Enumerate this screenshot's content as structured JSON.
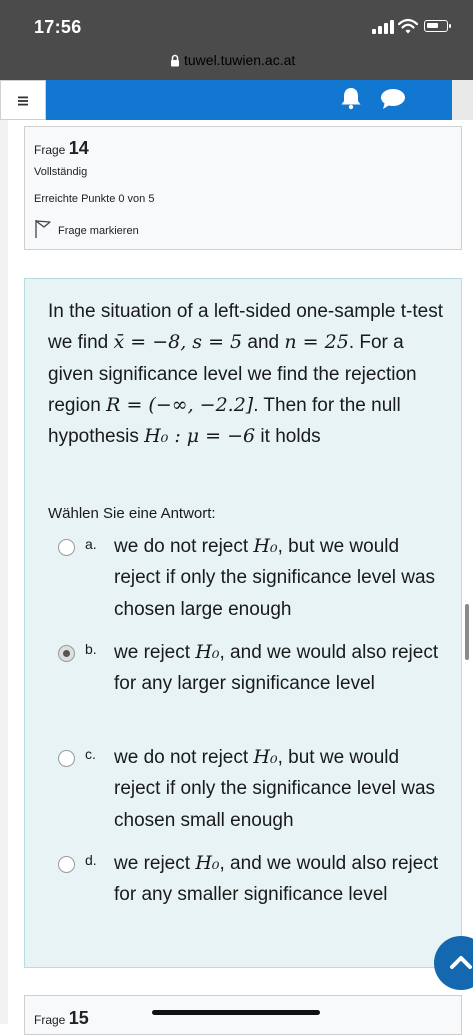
{
  "status_bar": {
    "time": "17:56"
  },
  "browser": {
    "url": "tuwel.tuwien.ac.at"
  },
  "nav": {
    "menu_icon": "hamburger-icon",
    "bell_icon": "bell-icon",
    "chat_icon": "chat-bubble-icon",
    "accent": "#1177d1"
  },
  "question_info": {
    "frage_label": "Frage",
    "number": "14",
    "status": "Vollständig",
    "points": "Erreichte Punkte 0 von 5",
    "flag_label": "Frage markieren"
  },
  "question": {
    "t1": "In the situation of a left-sided one-sample t-test we find ",
    "m1": "x̄ = −8, s = 5",
    "t2": " and ",
    "m2": "n = 25",
    "t3": ". For a given significance level we find the rejection region ",
    "m3": "R = (−∞, −2.2]",
    "t4": ". Then for the null hypothesis ",
    "m4": "H₀ : μ = −6",
    "t5": " it holds",
    "prompt": "Wählen Sie eine Antwort:"
  },
  "options": [
    {
      "letter": "a.",
      "pre": "we do not reject ",
      "math": "H₀",
      "post": ", but we would reject if only the significance level was chosen large enough",
      "selected": false
    },
    {
      "letter": "b.",
      "pre": "we reject ",
      "math": "H₀",
      "post": ", and we would also reject for any larger significance level",
      "selected": true
    },
    {
      "letter": "c.",
      "pre": "we do not reject ",
      "math": "H₀",
      "post": ", but we would reject if only the significance level was chosen small enough",
      "selected": false
    },
    {
      "letter": "d.",
      "pre": "we reject ",
      "math": "H₀",
      "post": ", and we would also reject for any smaller significance level",
      "selected": false
    }
  ],
  "next_question": {
    "frage_label": "Frage",
    "number": "15"
  }
}
